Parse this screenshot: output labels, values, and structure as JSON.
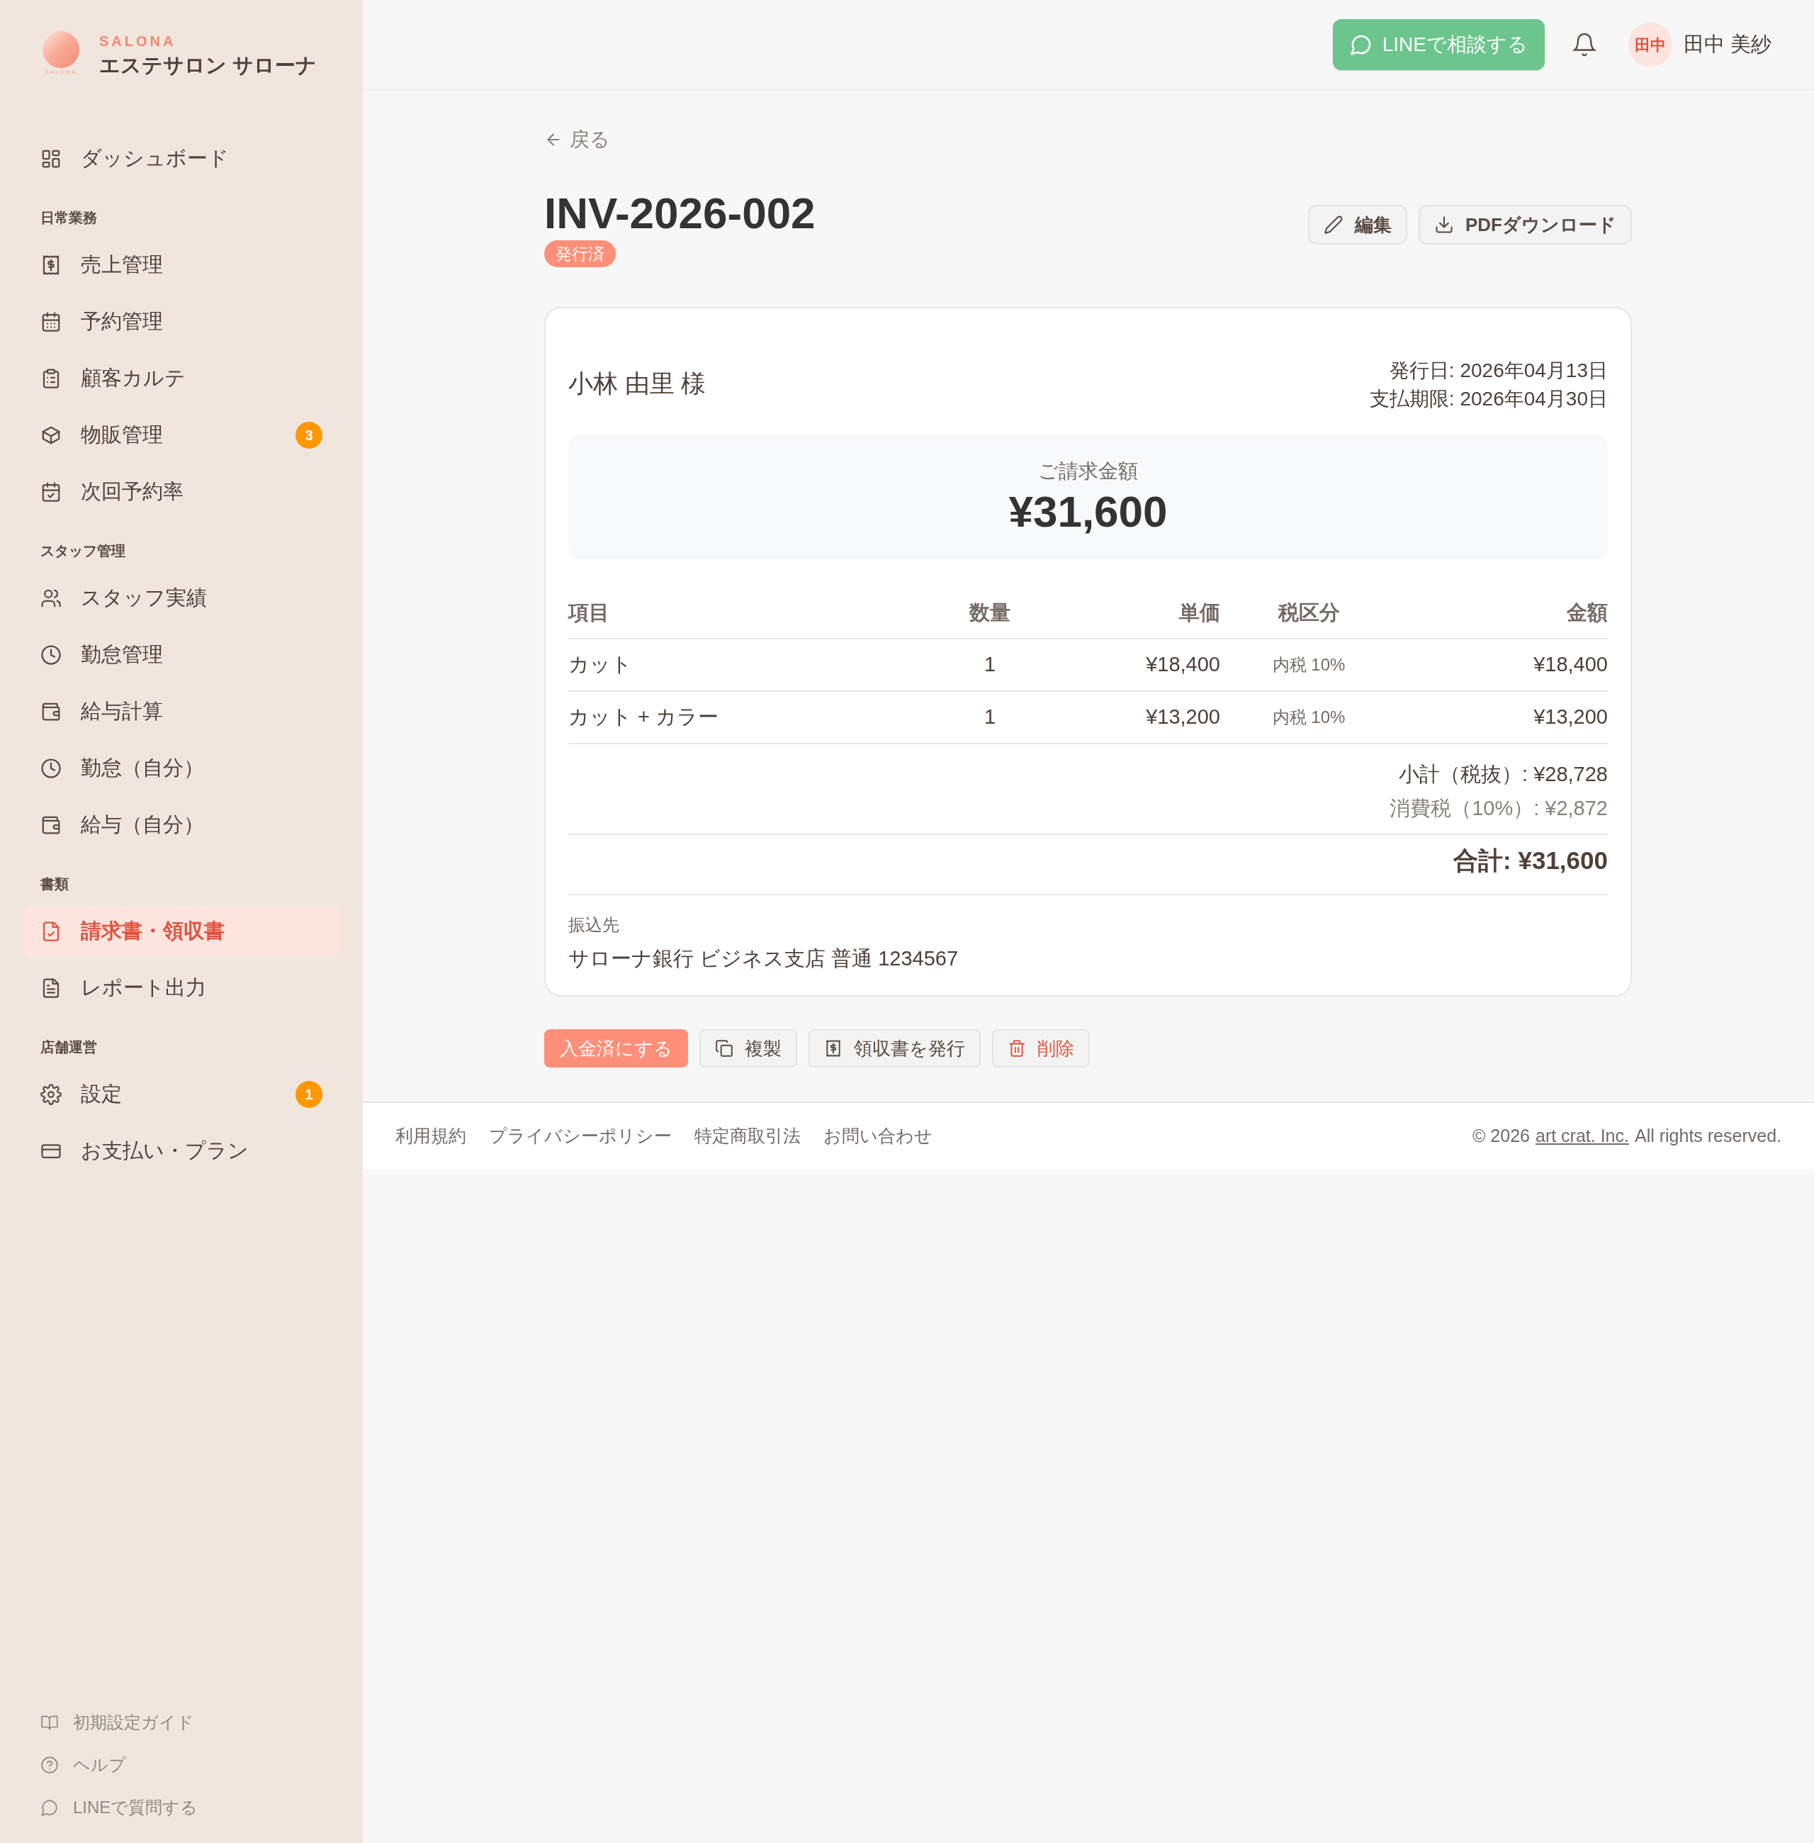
{
  "brand": {
    "mark_text": "SALONA",
    "eyebrow": "SALONA",
    "name": "エステサロン サローナ"
  },
  "nav": [
    {
      "items": [
        {
          "label": "ダッシュボード",
          "selected": false
        }
      ]
    },
    {
      "heading": "日常業務",
      "items": [
        {
          "label": "売上管理",
          "selected": false
        },
        {
          "label": "予約管理",
          "selected": false
        },
        {
          "label": "顧客カルテ",
          "selected": false
        },
        {
          "label": "物販管理",
          "selected": false,
          "badge": "3"
        },
        {
          "label": "次回予約率",
          "selected": false
        }
      ]
    },
    {
      "heading": "スタッフ管理",
      "items": [
        {
          "label": "スタッフ実績",
          "selected": false
        },
        {
          "label": "勤怠管理",
          "selected": false
        },
        {
          "label": "給与計算",
          "selected": false
        },
        {
          "label": "勤怠（自分）",
          "selected": false
        },
        {
          "label": "給与（自分）",
          "selected": false
        }
      ]
    },
    {
      "heading": "書類",
      "items": [
        {
          "label": "請求書・領収書",
          "selected": true
        },
        {
          "label": "レポート出力",
          "selected": false
        }
      ]
    },
    {
      "heading": "店舗運営",
      "items": [
        {
          "label": "設定",
          "selected": false,
          "badge": "1"
        },
        {
          "label": "お支払い・プラン",
          "selected": false
        }
      ]
    }
  ],
  "sidebar_footer": [
    "初期設定ガイド",
    "ヘルプ",
    "LINEで質問する"
  ],
  "header": {
    "line_button": "LINEで相談する",
    "avatar": "田中",
    "user_name": "田中 美紗"
  },
  "back_link": "戻る",
  "invoice": {
    "number": "INV-2026-002",
    "status": "発行済",
    "actions": [
      "編集",
      "PDFダウンロード"
    ],
    "client": "小林 由里 様",
    "issue_date": "発行日: 2026年04月13日",
    "due_date": "支払期限: 2026年04月30日",
    "amount_label": "ご請求金額",
    "amount": "¥31,600",
    "columns": [
      "項目",
      "数量",
      "単価",
      "税区分",
      "金額"
    ],
    "rows": [
      [
        "カット",
        "1",
        "¥18,400",
        "内税 10%",
        "¥18,400"
      ],
      [
        "カット + カラー",
        "1",
        "¥13,200",
        "内税 10%",
        "¥13,200"
      ]
    ],
    "subtotal": "小計（税抜）: ¥28,728",
    "tax": "消費税（10%）: ¥2,872",
    "total": "合計: ¥31,600",
    "bank_label": "振込先",
    "bank": "サローナ銀行 ビジネス支店 普通 1234567"
  },
  "bottom_actions": [
    {
      "label": "入金済にする",
      "kind": "primary"
    },
    {
      "label": "複製",
      "kind": "copy"
    },
    {
      "label": "領収書を発行",
      "kind": "receipt"
    },
    {
      "label": "削除",
      "kind": "danger"
    }
  ],
  "footer": {
    "links": [
      "利用規約",
      "プライバシーポリシー",
      "特定商取引法",
      "お問い合わせ"
    ],
    "copyright_prefix": "© 2026",
    "company_link": "art crat. Inc.",
    "copyright_suffix": "All rights reserved."
  }
}
